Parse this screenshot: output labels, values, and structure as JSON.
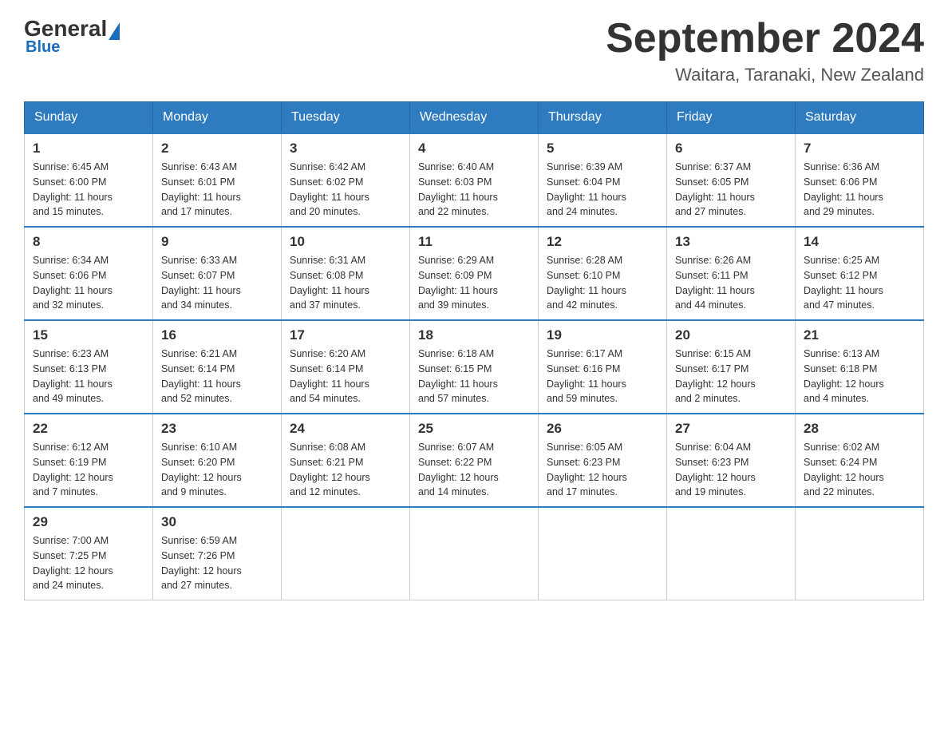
{
  "header": {
    "logo_general": "General",
    "logo_blue": "Blue",
    "month_title": "September 2024",
    "location": "Waitara, Taranaki, New Zealand"
  },
  "days_of_week": [
    "Sunday",
    "Monday",
    "Tuesday",
    "Wednesday",
    "Thursday",
    "Friday",
    "Saturday"
  ],
  "weeks": [
    [
      {
        "day": "1",
        "sunrise": "6:45 AM",
        "sunset": "6:00 PM",
        "daylight": "11 hours and 15 minutes."
      },
      {
        "day": "2",
        "sunrise": "6:43 AM",
        "sunset": "6:01 PM",
        "daylight": "11 hours and 17 minutes."
      },
      {
        "day": "3",
        "sunrise": "6:42 AM",
        "sunset": "6:02 PM",
        "daylight": "11 hours and 20 minutes."
      },
      {
        "day": "4",
        "sunrise": "6:40 AM",
        "sunset": "6:03 PM",
        "daylight": "11 hours and 22 minutes."
      },
      {
        "day": "5",
        "sunrise": "6:39 AM",
        "sunset": "6:04 PM",
        "daylight": "11 hours and 24 minutes."
      },
      {
        "day": "6",
        "sunrise": "6:37 AM",
        "sunset": "6:05 PM",
        "daylight": "11 hours and 27 minutes."
      },
      {
        "day": "7",
        "sunrise": "6:36 AM",
        "sunset": "6:06 PM",
        "daylight": "11 hours and 29 minutes."
      }
    ],
    [
      {
        "day": "8",
        "sunrise": "6:34 AM",
        "sunset": "6:06 PM",
        "daylight": "11 hours and 32 minutes."
      },
      {
        "day": "9",
        "sunrise": "6:33 AM",
        "sunset": "6:07 PM",
        "daylight": "11 hours and 34 minutes."
      },
      {
        "day": "10",
        "sunrise": "6:31 AM",
        "sunset": "6:08 PM",
        "daylight": "11 hours and 37 minutes."
      },
      {
        "day": "11",
        "sunrise": "6:29 AM",
        "sunset": "6:09 PM",
        "daylight": "11 hours and 39 minutes."
      },
      {
        "day": "12",
        "sunrise": "6:28 AM",
        "sunset": "6:10 PM",
        "daylight": "11 hours and 42 minutes."
      },
      {
        "day": "13",
        "sunrise": "6:26 AM",
        "sunset": "6:11 PM",
        "daylight": "11 hours and 44 minutes."
      },
      {
        "day": "14",
        "sunrise": "6:25 AM",
        "sunset": "6:12 PM",
        "daylight": "11 hours and 47 minutes."
      }
    ],
    [
      {
        "day": "15",
        "sunrise": "6:23 AM",
        "sunset": "6:13 PM",
        "daylight": "11 hours and 49 minutes."
      },
      {
        "day": "16",
        "sunrise": "6:21 AM",
        "sunset": "6:14 PM",
        "daylight": "11 hours and 52 minutes."
      },
      {
        "day": "17",
        "sunrise": "6:20 AM",
        "sunset": "6:14 PM",
        "daylight": "11 hours and 54 minutes."
      },
      {
        "day": "18",
        "sunrise": "6:18 AM",
        "sunset": "6:15 PM",
        "daylight": "11 hours and 57 minutes."
      },
      {
        "day": "19",
        "sunrise": "6:17 AM",
        "sunset": "6:16 PM",
        "daylight": "11 hours and 59 minutes."
      },
      {
        "day": "20",
        "sunrise": "6:15 AM",
        "sunset": "6:17 PM",
        "daylight": "12 hours and 2 minutes."
      },
      {
        "day": "21",
        "sunrise": "6:13 AM",
        "sunset": "6:18 PM",
        "daylight": "12 hours and 4 minutes."
      }
    ],
    [
      {
        "day": "22",
        "sunrise": "6:12 AM",
        "sunset": "6:19 PM",
        "daylight": "12 hours and 7 minutes."
      },
      {
        "day": "23",
        "sunrise": "6:10 AM",
        "sunset": "6:20 PM",
        "daylight": "12 hours and 9 minutes."
      },
      {
        "day": "24",
        "sunrise": "6:08 AM",
        "sunset": "6:21 PM",
        "daylight": "12 hours and 12 minutes."
      },
      {
        "day": "25",
        "sunrise": "6:07 AM",
        "sunset": "6:22 PM",
        "daylight": "12 hours and 14 minutes."
      },
      {
        "day": "26",
        "sunrise": "6:05 AM",
        "sunset": "6:23 PM",
        "daylight": "12 hours and 17 minutes."
      },
      {
        "day": "27",
        "sunrise": "6:04 AM",
        "sunset": "6:23 PM",
        "daylight": "12 hours and 19 minutes."
      },
      {
        "day": "28",
        "sunrise": "6:02 AM",
        "sunset": "6:24 PM",
        "daylight": "12 hours and 22 minutes."
      }
    ],
    [
      {
        "day": "29",
        "sunrise": "7:00 AM",
        "sunset": "7:25 PM",
        "daylight": "12 hours and 24 minutes."
      },
      {
        "day": "30",
        "sunrise": "6:59 AM",
        "sunset": "7:26 PM",
        "daylight": "12 hours and 27 minutes."
      },
      null,
      null,
      null,
      null,
      null
    ]
  ],
  "labels": {
    "sunrise": "Sunrise:",
    "sunset": "Sunset:",
    "daylight": "Daylight:"
  }
}
